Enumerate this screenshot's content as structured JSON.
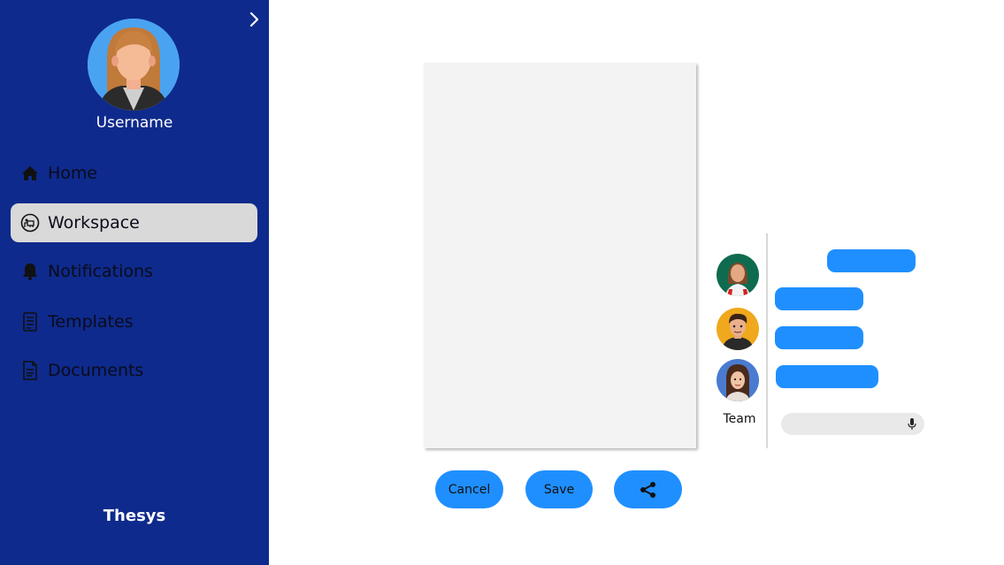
{
  "sidebar": {
    "username": "Username",
    "items": [
      {
        "label": "Home",
        "icon": "home-icon"
      },
      {
        "label": "Workspace",
        "icon": "workspace-icon"
      },
      {
        "label": "Notifications",
        "icon": "bell-icon"
      },
      {
        "label": "Templates",
        "icon": "templates-icon"
      },
      {
        "label": "Documents",
        "icon": "document-icon"
      }
    ],
    "active_item": "Workspace",
    "brand": "Thesys"
  },
  "actions": {
    "cancel_label": "Cancel",
    "save_label": "Save",
    "share_icon": "share-icon"
  },
  "team": {
    "label": "Team",
    "members": 3,
    "message_count": 4
  },
  "colors": {
    "sidebar_bg": "#0e2a8c",
    "accent": "#1f8fff",
    "active_item_bg": "#d9d9d9"
  }
}
